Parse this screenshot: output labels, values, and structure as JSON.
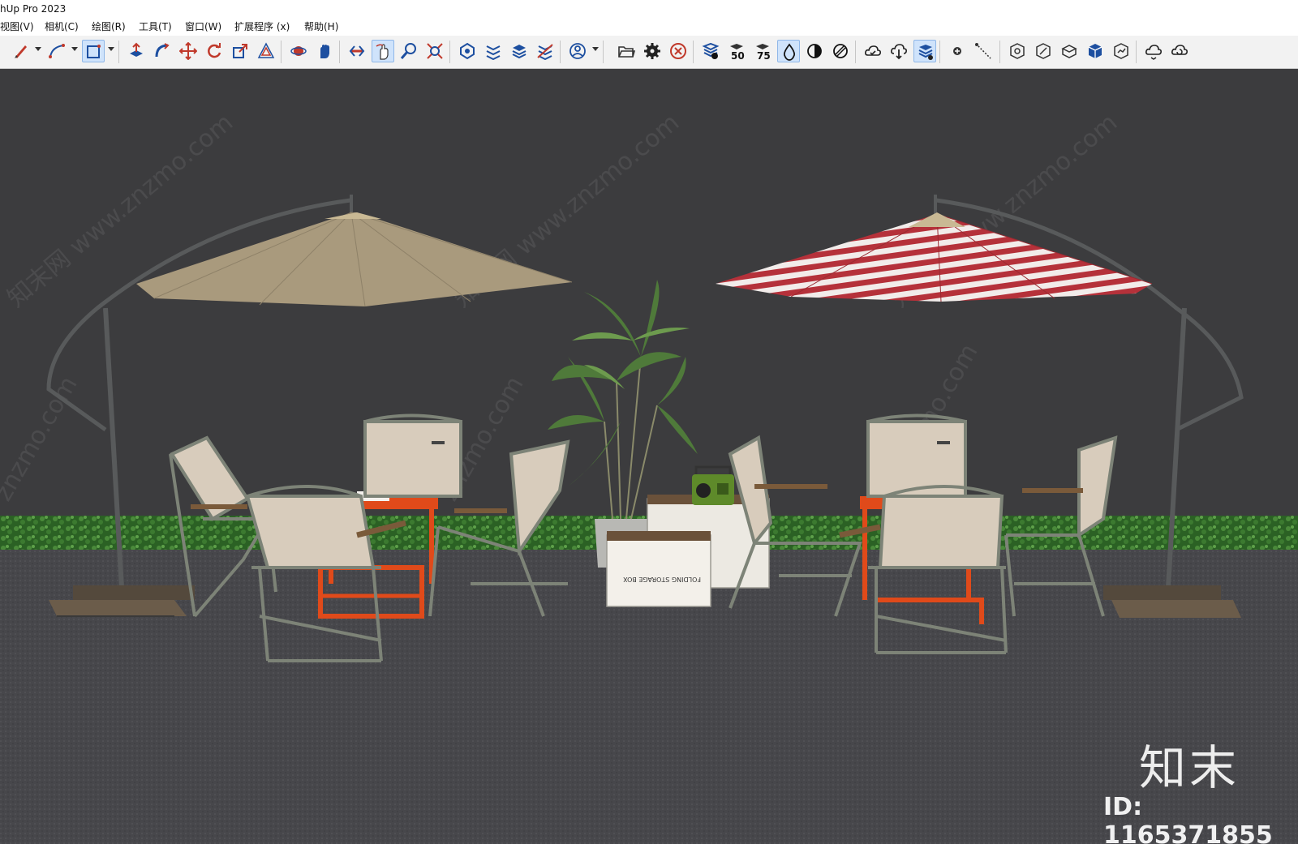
{
  "app": {
    "title": "hUp Pro 2023"
  },
  "menu": [
    {
      "label": "视图(V)"
    },
    {
      "label": "相机(C)"
    },
    {
      "label": "绘图(R)"
    },
    {
      "label": "工具(T)"
    },
    {
      "label": "窗口(W)"
    },
    {
      "label": "扩展程序 (x)"
    },
    {
      "label": "帮助(H)"
    }
  ],
  "toolbar": {
    "tools": [
      "pencil-icon",
      "arc-icon",
      "shape-icon",
      "push-pull-icon",
      "follow-me-icon",
      "move-icon",
      "rotate-icon",
      "scale-icon",
      "offset-icon",
      "orbit-icon",
      "pan-icon",
      "walk-icon",
      "look-around-icon",
      "zoom-icon",
      "zoom-extents-icon",
      "section-plane-icon",
      "section-display-icon",
      "section-fill-icon",
      "section-cuts-icon",
      "account-icon",
      "open-folder-icon",
      "settings-gear-icon",
      "cancel-icon",
      "xray-icon",
      "opacity-50-icon",
      "opacity-75-icon",
      "water-drop-icon",
      "contrast-icon",
      "hatch-icon",
      "cloud-check-icon",
      "cloud-download-icon",
      "cloud-layers-icon",
      "dot-icon",
      "dashed-line-icon",
      "view-iso-icon",
      "view-top-icon",
      "view-front-icon",
      "view-right-icon",
      "view-back-icon",
      "cloud-sync-icon",
      "cloud-refresh-icon"
    ],
    "opacity_50": "50",
    "opacity_75": "75"
  },
  "watermark": {
    "logo": "知末",
    "id": "ID: 1165371855",
    "repeat_text": "知末网 www.znzmo.com",
    "side_text": "znzmo.com"
  },
  "scene": {
    "storage_box_label": "FOLDING STORAGE BOX",
    "colors": {
      "wall": "#3c3c3e",
      "ground": "#46464a",
      "hedge": "#2f6b2a",
      "umbrella_left": "#a99a7d",
      "umbrella_right_red": "#b5313a",
      "table": "#e04a1a",
      "chair_fabric": "#d8ccbc",
      "chair_frame": "#7d8377"
    }
  }
}
